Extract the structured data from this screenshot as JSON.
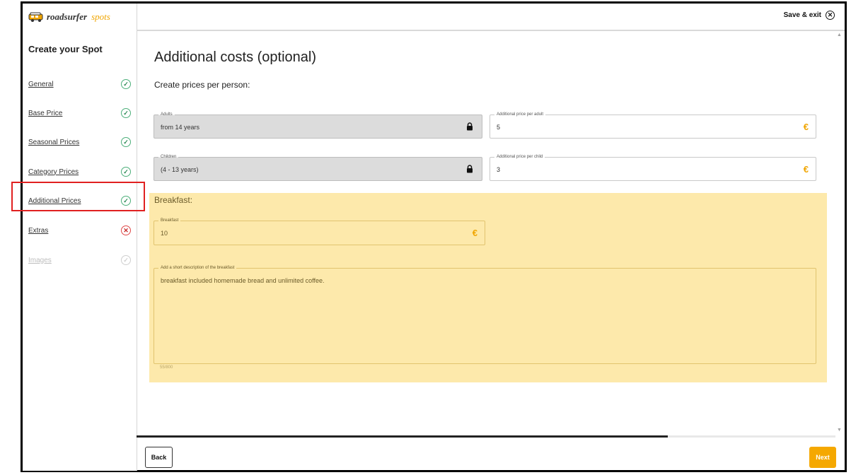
{
  "brand": {
    "name_part1": "roadsurfer",
    "name_part2": "spots",
    "accent": "#f0a500"
  },
  "header": {
    "save_exit_label": "Save & exit",
    "close_icon": "circle-x-icon"
  },
  "sidebar": {
    "title": "Create your Spot",
    "items": [
      {
        "label": "General",
        "status": "complete"
      },
      {
        "label": "Base Price",
        "status": "complete"
      },
      {
        "label": "Seasonal Prices",
        "status": "complete"
      },
      {
        "label": "Category Prices",
        "status": "complete"
      },
      {
        "label": "Additional Prices",
        "status": "complete",
        "highlighted": true
      },
      {
        "label": "Extras",
        "status": "error"
      },
      {
        "label": "Images",
        "status": "disabled"
      }
    ]
  },
  "main": {
    "title": "Additional costs (optional)",
    "subtitle": "Create prices per person:",
    "adults": {
      "label": "Adults",
      "value": "from 14 years",
      "icon": "lock-icon"
    },
    "adult_price": {
      "label": "Additional price per adult",
      "value": "5",
      "currency": "€"
    },
    "children": {
      "label": "Children",
      "value": "(4 - 13 years)",
      "icon": "lock-icon"
    },
    "child_price": {
      "label": "Additional price per child",
      "value": "3",
      "currency": "€"
    },
    "breakfast": {
      "section_title": "Breakfast:",
      "price_label": "Breakfast",
      "price_value": "10",
      "currency": "€",
      "description_label": "Add a short description of the breakfast",
      "description_value": "breakfast included homemade bread and unlimited coffee.",
      "counter": "55/800",
      "panel_color": "#fde9ab"
    }
  },
  "progress": {
    "fraction": 0.76
  },
  "footer": {
    "back_label": "Back",
    "next_label": "Next",
    "next_color": "#f5a800"
  }
}
